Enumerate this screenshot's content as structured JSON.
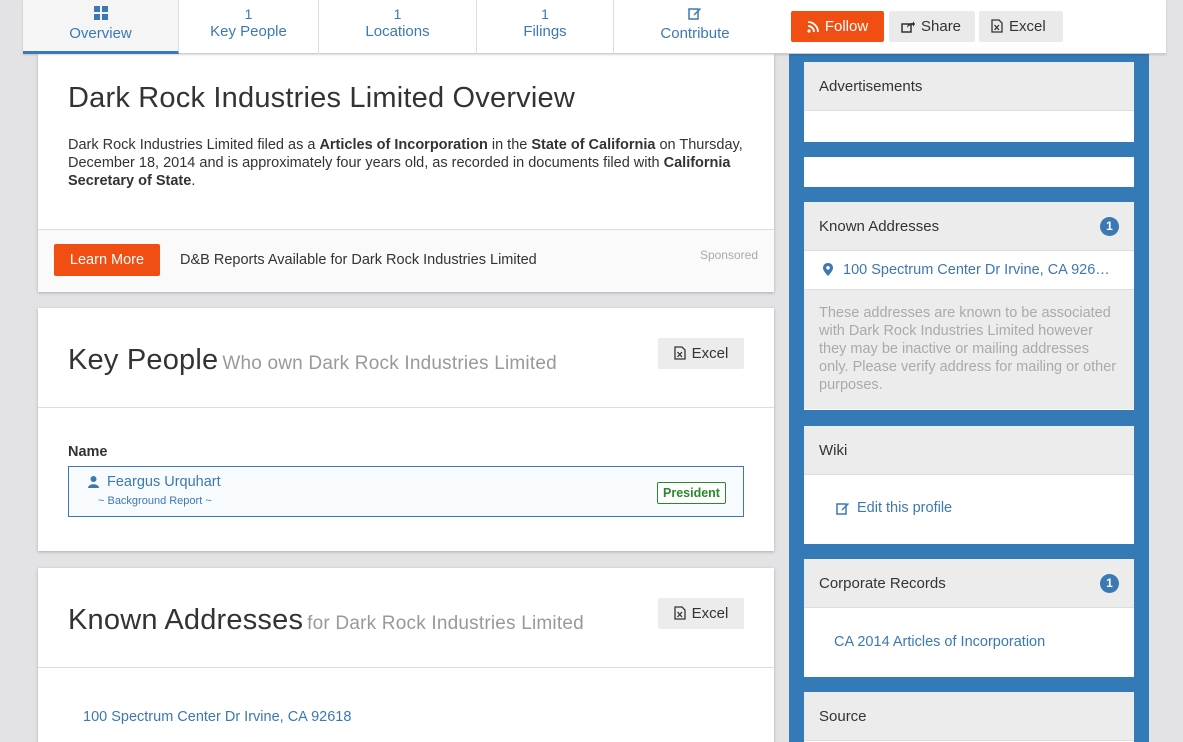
{
  "tabs": [
    {
      "count": "",
      "label": "Overview",
      "icon": "grid-icon"
    },
    {
      "count": "1",
      "label": "Key People"
    },
    {
      "count": "1",
      "label": "Locations"
    },
    {
      "count": "1",
      "label": "Filings"
    },
    {
      "count": "",
      "label": "Contribute",
      "icon": "edit-icon"
    }
  ],
  "actions": {
    "follow": "Follow",
    "share": "Share",
    "excel": "Excel"
  },
  "overview": {
    "title": "Dark Rock Industries Limited Overview",
    "p1": "Dark Rock Industries Limited filed as a ",
    "b1": "Articles of Incorporation",
    "p2": " in the ",
    "b2": "State of California",
    "p3": " on Thursday, December 18, 2014 and is approximately four years old, as recorded in documents filed with ",
    "b3": "California Secretary of State",
    "p4": ".",
    "learn_more": "Learn More",
    "ad_text": "D&B Reports Available for Dark Rock Industries Limited",
    "sponsored": "Sponsored"
  },
  "key_people": {
    "title": "Key People",
    "subtitle": "Who own Dark Rock Industries Limited",
    "excel": "Excel",
    "col_name": "Name",
    "person_name": "Feargus Urquhart",
    "background_report": "~ Background Report ~",
    "role": "President"
  },
  "known_addresses": {
    "title": "Known Addresses",
    "subtitle": "for Dark Rock Industries Limited",
    "excel": "Excel",
    "address": "100 Spectrum Center Dr Irvine, CA 92618"
  },
  "sidebar": {
    "ads_title": "Advertisements",
    "addresses_title": "Known Addresses",
    "addresses_count": "1",
    "address_short": "100 Spectrum Center Dr Irvine, CA 926…",
    "addresses_note": "These addresses are known to be associated with Dark Rock Industries Limited however they may be inactive or mailing addresses only. Please verify address for mailing or other purposes.",
    "wiki_title": "Wiki",
    "edit_profile": "Edit this profile",
    "records_title": "Corporate Records",
    "records_count": "1",
    "record_link": "CA 2014 Articles of Incorporation",
    "source_title": "Source"
  },
  "colors": {
    "accent": "#3c78b4",
    "follow": "#f04e12",
    "sidebar_bg": "#337ab7",
    "role_green": "#2a8a2a"
  }
}
